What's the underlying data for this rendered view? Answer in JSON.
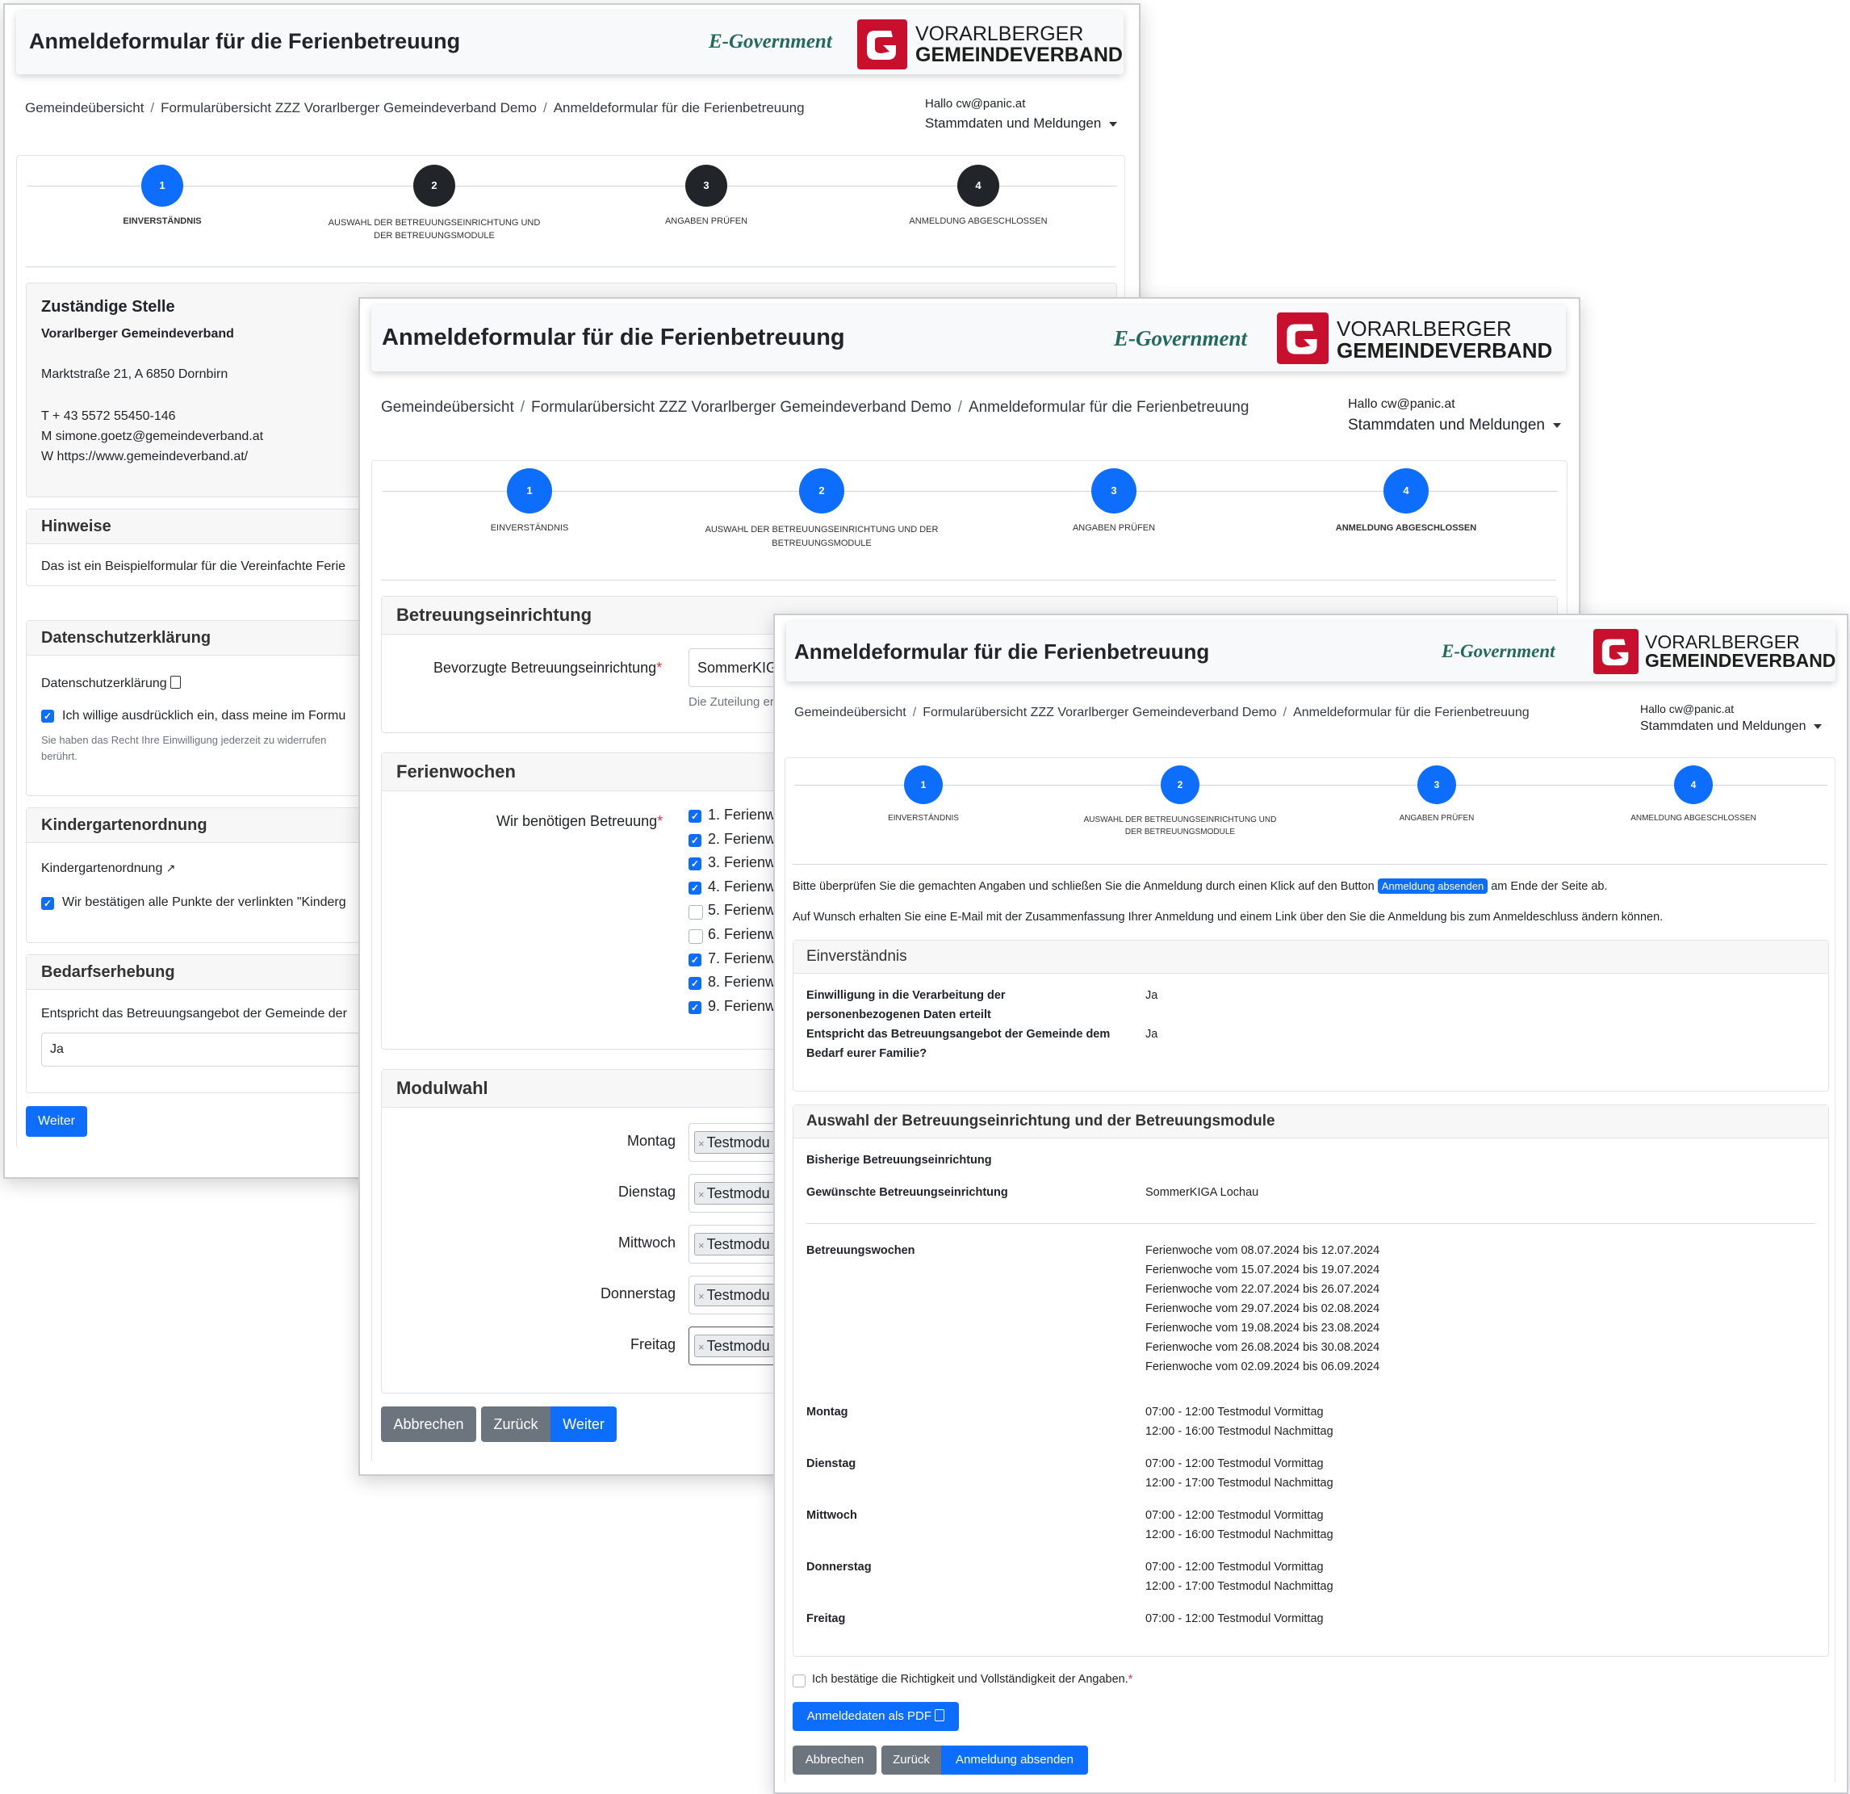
{
  "header": {
    "title": "Anmeldeformular für die Ferienbetreuung",
    "egov": "E-Government",
    "logo_line1": "VORARLBERGER",
    "logo_line2": "GEMEINDEVERBAND"
  },
  "breadcrumb": {
    "item1": "Gemeindeübersicht",
    "item2": "Formularübersicht ZZZ Vorarlberger Gemeindeverband Demo",
    "item3": "Anmeldeformular für die Ferienbetreuung"
  },
  "user": {
    "greeting": "Hallo cw@panic.at",
    "menu": "Stammdaten und Meldungen"
  },
  "steps": [
    {
      "num": "1",
      "label": "EINVERSTÄNDNIS"
    },
    {
      "num": "2",
      "label": "AUSWAHL DER BETREUUNGSEINRICHTUNG UND DER BETREUUNGSMODULE"
    },
    {
      "num": "3",
      "label": "ANGABEN PRÜFEN"
    },
    {
      "num": "4",
      "label": "ANMELDUNG ABGESCHLOSSEN"
    }
  ],
  "window1": {
    "zustaendig": {
      "title": "Zuständige Stelle",
      "org": "Vorarlberger Gemeindeverband",
      "address": "Marktstraße 21, A 6850 Dornbirn",
      "phone": "T + 43 5572 55450-146",
      "mail": "M simone.goetz@gemeindeverband.at",
      "web": "W https://www.gemeindeverband.at/"
    },
    "hinweise": {
      "title": "Hinweise",
      "text": "Das ist ein Beispielformular für die Vereinfachte Ferie"
    },
    "datenschutz": {
      "title": "Datenschutzerklärung",
      "link": "Datenschutzerklärung",
      "consent": "Ich willige ausdrücklich ein, dass meine im Formu",
      "note1": "Sie haben das Recht Ihre Einwilligung jederzeit zu widerrufen",
      "note2": "berührt."
    },
    "kiga": {
      "title": "Kindergartenordnung",
      "link": "Kindergartenordnung",
      "confirm": "Wir bestätigen alle Punkte der verlinkten \"Kinderg"
    },
    "bedarf": {
      "title": "Bedarfserhebung",
      "question": "Entspricht das Betreuungsangebot der Gemeinde der",
      "answer": "Ja"
    },
    "next": "Weiter"
  },
  "window2": {
    "einrichtung": {
      "title": "Betreuungseinrichtung",
      "label": "Bevorzugte Betreuungseinrichtung",
      "value": "SommerKIG",
      "hint": "Die Zuteilung er"
    },
    "wochen": {
      "title": "Ferienwochen",
      "label": "Wir benötigen Betreuung",
      "items": [
        {
          "label": "1. Ferienw",
          "checked": true
        },
        {
          "label": "2. Ferienw",
          "checked": true
        },
        {
          "label": "3. Ferienw",
          "checked": true
        },
        {
          "label": "4. Ferienw",
          "checked": true
        },
        {
          "label": "5. Ferienw",
          "checked": false
        },
        {
          "label": "6. Ferienw",
          "checked": false
        },
        {
          "label": "7. Ferienw",
          "checked": true
        },
        {
          "label": "8. Ferienw",
          "checked": true
        },
        {
          "label": "9. Ferienw",
          "checked": true
        }
      ]
    },
    "modul": {
      "title": "Modulwahl",
      "days": [
        "Montag",
        "Dienstag",
        "Mittwoch",
        "Donnerstag",
        "Freitag"
      ],
      "tag": "Testmodu"
    },
    "cancel": "Abbrechen",
    "back": "Zurück",
    "next": "Weiter"
  },
  "window3": {
    "intro1_pre": "Bitte überprüfen Sie die gemachten Angaben und schließen Sie die Anmeldung durch einen Klick auf den Button",
    "intro1_btn": "Anmeldung absenden",
    "intro1_post": "am Ende der Seite ab.",
    "intro2": "Auf Wunsch erhalten Sie eine E-Mail mit der Zusammenfassung Ihrer Anmeldung und einem Link über den Sie die Anmeldung bis zum Anmeldeschluss ändern können.",
    "einv": {
      "title": "Einverständnis",
      "q1a": "Einwilligung in die Verarbeitung der",
      "q1b": "personenbezogenen Daten erteilt",
      "a1": "Ja",
      "q2a": "Entspricht das Betreuungsangebot der Gemeinde dem",
      "q2b": "Bedarf eurer Familie?",
      "a2": "Ja"
    },
    "auswahl": {
      "title": "Auswahl der Betreuungseinrichtung und der Betreuungsmodule",
      "bisherig": "Bisherige Betreuungseinrichtung",
      "gewuenscht": "Gewünschte Betreuungseinrichtung",
      "gewuenscht_val": "SommerKIGA Lochau",
      "wochen_label": "Betreuungswochen",
      "wochen": [
        "Ferienwoche vom 08.07.2024 bis 12.07.2024",
        "Ferienwoche vom 15.07.2024 bis 19.07.2024",
        "Ferienwoche vom 22.07.2024 bis 26.07.2024",
        "Ferienwoche vom 29.07.2024 bis 02.08.2024",
        "Ferienwoche vom 19.08.2024 bis 23.08.2024",
        "Ferienwoche vom 26.08.2024 bis 30.08.2024",
        "Ferienwoche vom 02.09.2024 bis 06.09.2024"
      ],
      "days": [
        {
          "day": "Montag",
          "lines": [
            "07:00 - 12:00 Testmodul Vormittag",
            "12:00 - 16:00 Testmodul Nachmittag"
          ]
        },
        {
          "day": "Dienstag",
          "lines": [
            "07:00 - 12:00 Testmodul Vormittag",
            "12:00 - 17:00 Testmodul Nachmittag"
          ]
        },
        {
          "day": "Mittwoch",
          "lines": [
            "07:00 - 12:00 Testmodul Vormittag",
            "12:00 - 16:00 Testmodul Nachmittag"
          ]
        },
        {
          "day": "Donnerstag",
          "lines": [
            "07:00 - 12:00 Testmodul Vormittag",
            "12:00 - 17:00 Testmodul Nachmittag"
          ]
        },
        {
          "day": "Freitag",
          "lines": [
            "07:00 - 12:00 Testmodul Vormittag",
            ""
          ]
        }
      ]
    },
    "confirm": "Ich bestätige die Richtigkeit und Vollständigkeit der Angaben.",
    "pdf": "Anmeldedaten als PDF",
    "cancel": "Abbrechen",
    "back": "Zurück",
    "submit": "Anmeldung absenden"
  },
  "colors": {
    "primary": "#0d6efd",
    "step_done": "#0d6efd",
    "step_pending": "#212529",
    "secondary": "#6c757d",
    "brand_red": "#c8102e",
    "egov_green": "#236a5e"
  }
}
